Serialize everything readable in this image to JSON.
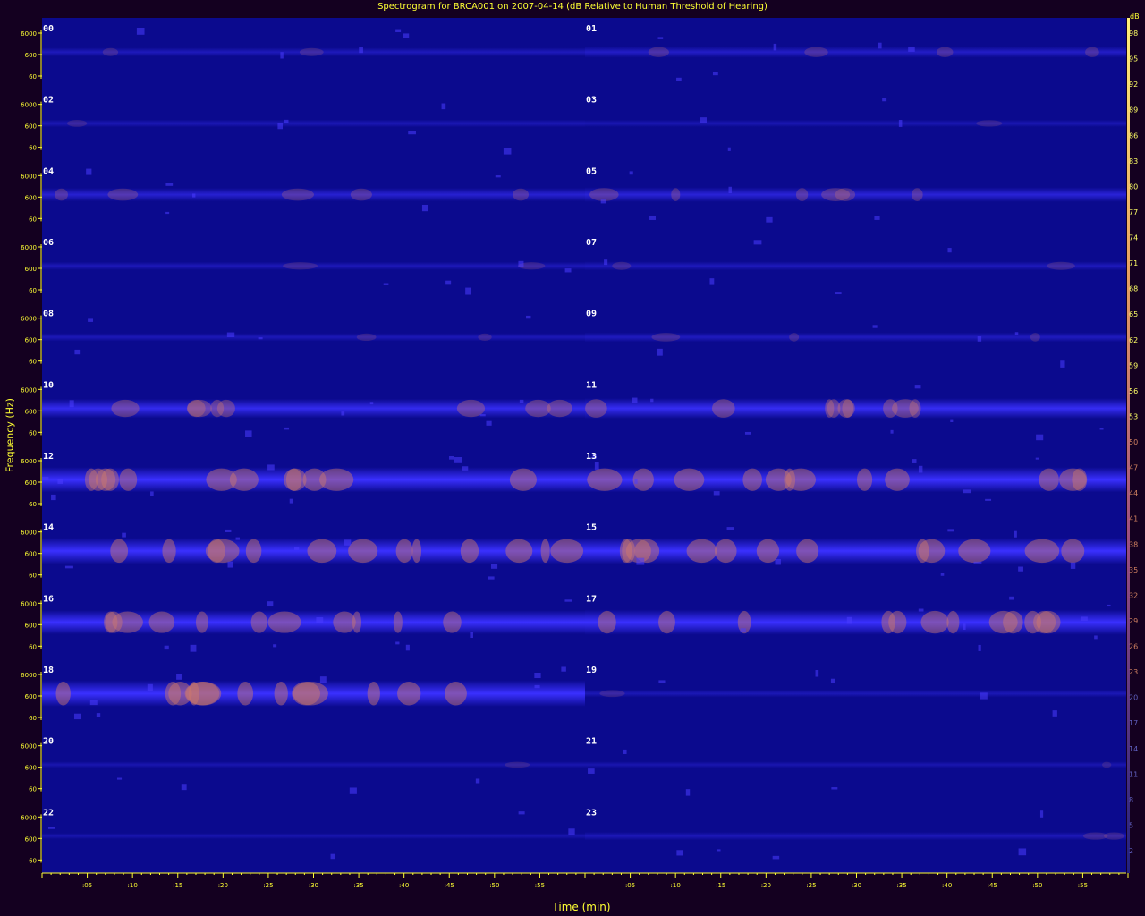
{
  "chart_data": {
    "type": "heatmap",
    "title": "Spectrogram for BRCA001 on 2007-04-14 (dB Relative to Human Threshold of Hearing)",
    "xlabel": "Time (min)",
    "ylabel": "Frequency (Hz)",
    "colorbar_unit": "dB",
    "colorbar_ticks": [
      98,
      95,
      92,
      89,
      86,
      83,
      80,
      77,
      74,
      71,
      68,
      65,
      62,
      59,
      56,
      53,
      50,
      47,
      44,
      41,
      38,
      35,
      32,
      29,
      26,
      23,
      20,
      17,
      14,
      11,
      8,
      5,
      2
    ],
    "freq_ticks": [
      "6000",
      "600",
      "60"
    ],
    "x_ticks_left": [
      ":05",
      ":10",
      ":15",
      ":20",
      ":25",
      ":30",
      ":35",
      ":40",
      ":45",
      ":50",
      ":55"
    ],
    "x_ticks_right": [
      ":05",
      ":10",
      ":15",
      ":20",
      ":25",
      ":30",
      ":35",
      ":40",
      ":45",
      ":50",
      ":55"
    ],
    "hour_labels": [
      "00",
      "01",
      "02",
      "03",
      "04",
      "05",
      "06",
      "07",
      "08",
      "09",
      "10",
      "11",
      "12",
      "13",
      "14",
      "15",
      "16",
      "17",
      "18",
      "19",
      "20",
      "21",
      "22",
      "23"
    ],
    "band_intensity_by_row": [
      {
        "row": 0,
        "left": 0.15,
        "right": 0.25
      },
      {
        "row": 1,
        "left": 0.1,
        "right": 0.08
      },
      {
        "row": 2,
        "left": 0.35,
        "right": 0.4
      },
      {
        "row": 3,
        "left": 0.12,
        "right": 0.15
      },
      {
        "row": 4,
        "left": 0.12,
        "right": 0.18
      },
      {
        "row": 5,
        "left": 0.6,
        "right": 0.65
      },
      {
        "row": 6,
        "left": 0.85,
        "right": 0.85
      },
      {
        "row": 7,
        "left": 0.9,
        "right": 0.9
      },
      {
        "row": 8,
        "left": 0.8,
        "right": 0.85
      },
      {
        "row": 9,
        "left": 0.9,
        "right": 0.1
      },
      {
        "row": 10,
        "left": 0.05,
        "right": 0.05
      },
      {
        "row": 11,
        "left": 0.03,
        "right": 0.12
      }
    ]
  },
  "colors": {
    "background": "#140020",
    "plot_background": "#0b0a8e",
    "band": "#3a30ff",
    "hot": "#d07a6a",
    "tick_text": "#ffff33",
    "hour_label": "#ffffff"
  }
}
